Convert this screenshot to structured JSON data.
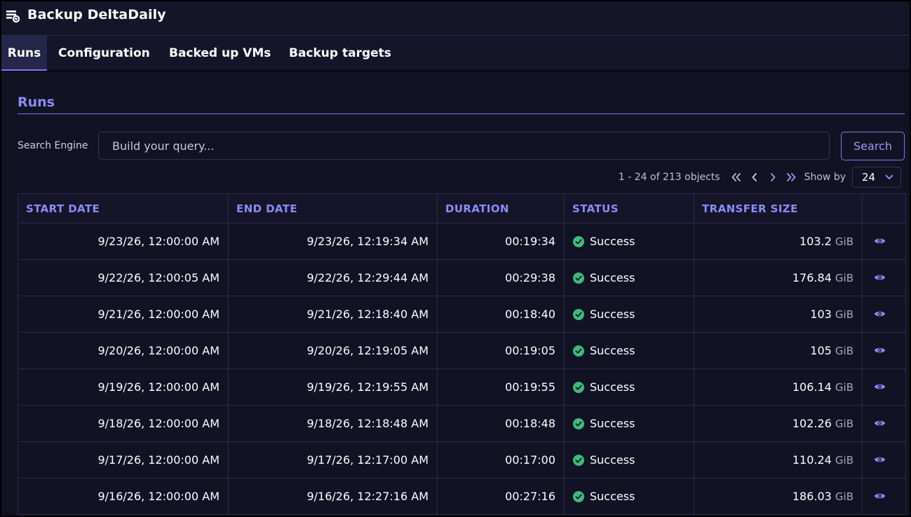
{
  "app": {
    "title": "Backup DeltaDaily",
    "icon": "backup-job-icon"
  },
  "tabs": [
    {
      "label": "Runs",
      "active": true
    },
    {
      "label": "Configuration",
      "active": false
    },
    {
      "label": "Backed up VMs",
      "active": false
    },
    {
      "label": "Backup targets",
      "active": false
    }
  ],
  "section": {
    "title": "Runs"
  },
  "search": {
    "label": "Search Engine",
    "placeholder": "Build your query...",
    "button_label": "Search"
  },
  "pager": {
    "range_text": "1 - 24 of 213 objects",
    "show_by_label": "Show by",
    "show_by_value": "24"
  },
  "table": {
    "columns": [
      "START DATE",
      "END DATE",
      "DURATION",
      "STATUS",
      "TRANSFER SIZE"
    ],
    "rows": [
      {
        "start": "9/23/26, 12:00:00 AM",
        "end": "9/23/26, 12:19:34 AM",
        "duration": "00:19:34",
        "status": "Success",
        "size": "103.2",
        "unit": "GiB"
      },
      {
        "start": "9/22/26, 12:00:05 AM",
        "end": "9/22/26, 12:29:44 AM",
        "duration": "00:29:38",
        "status": "Success",
        "size": "176.84",
        "unit": "GiB"
      },
      {
        "start": "9/21/26, 12:00:00 AM",
        "end": "9/21/26, 12:18:40 AM",
        "duration": "00:18:40",
        "status": "Success",
        "size": "103",
        "unit": "GiB"
      },
      {
        "start": "9/20/26, 12:00:00 AM",
        "end": "9/20/26, 12:19:05 AM",
        "duration": "00:19:05",
        "status": "Success",
        "size": "105",
        "unit": "GiB"
      },
      {
        "start": "9/19/26, 12:00:00 AM",
        "end": "9/19/26, 12:19:55 AM",
        "duration": "00:19:55",
        "status": "Success",
        "size": "106.14",
        "unit": "GiB"
      },
      {
        "start": "9/18/26, 12:00:00 AM",
        "end": "9/18/26, 12:18:48 AM",
        "duration": "00:18:48",
        "status": "Success",
        "size": "102.26",
        "unit": "GiB"
      },
      {
        "start": "9/17/26, 12:00:00 AM",
        "end": "9/17/26, 12:17:00 AM",
        "duration": "00:17:00",
        "status": "Success",
        "size": "110.24",
        "unit": "GiB"
      },
      {
        "start": "9/16/26, 12:00:00 AM",
        "end": "9/16/26, 12:27:16 AM",
        "duration": "00:27:16",
        "status": "Success",
        "size": "186.03",
        "unit": "GiB"
      }
    ]
  },
  "colors": {
    "accent": "#8c8cf5",
    "success": "#3dbb7b",
    "background": "#121225"
  }
}
